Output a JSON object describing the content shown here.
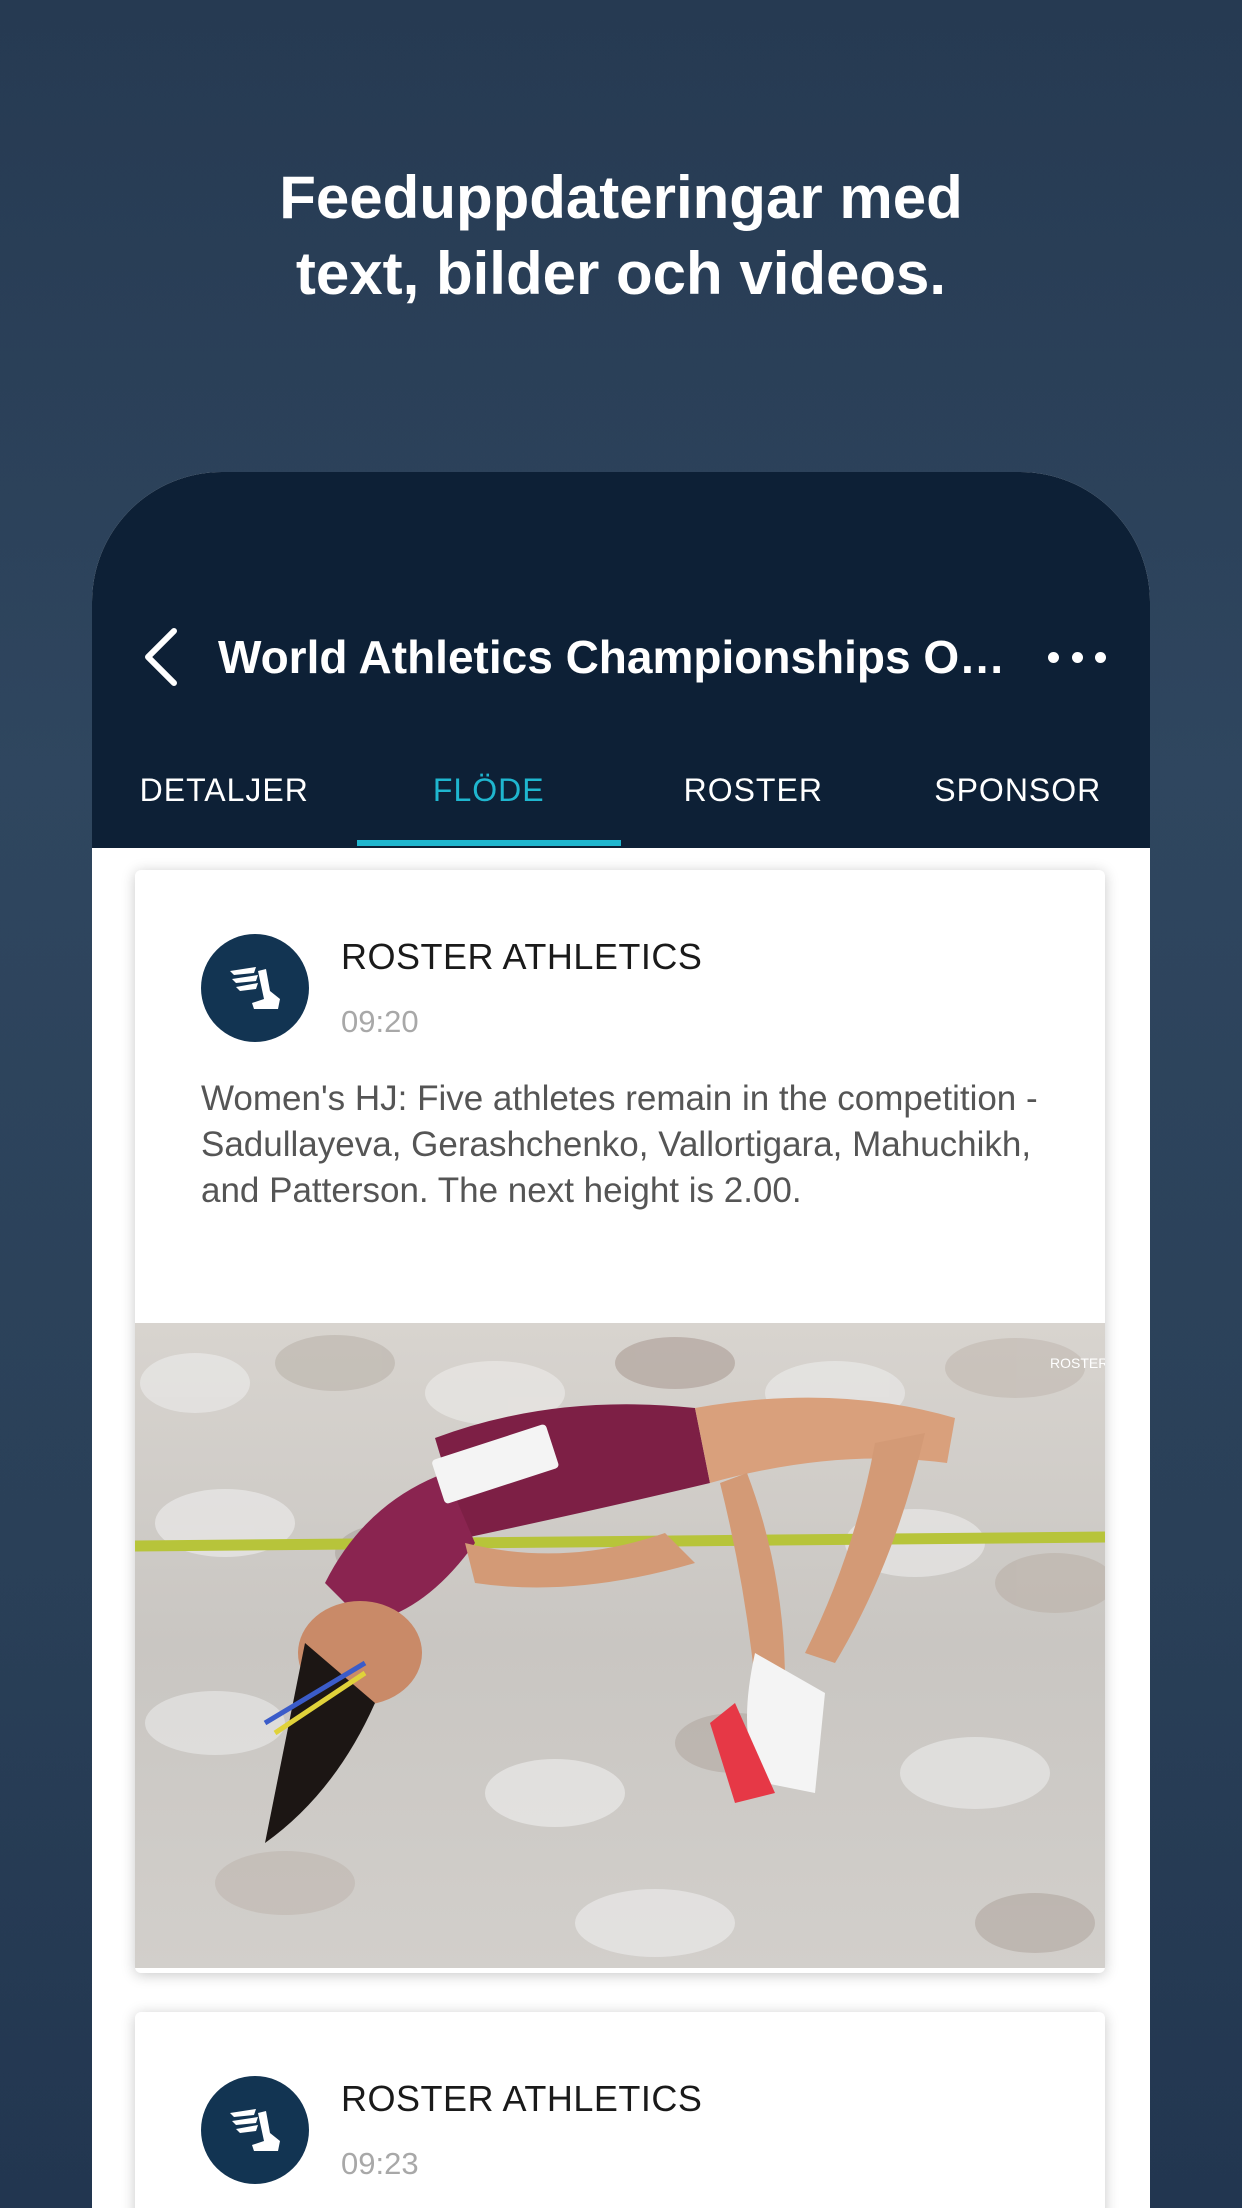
{
  "promo": {
    "headline_line1": "Feeduppdateringar med",
    "headline_line2": "text, bilder och videos."
  },
  "header": {
    "back_icon": "chevron-left-icon",
    "title": "World Athletics Championships Ore...",
    "more_icon": "more-horizontal-icon"
  },
  "tabs": [
    {
      "label": "DETALJER",
      "active": false
    },
    {
      "label": "FLÖDE",
      "active": true
    },
    {
      "label": "ROSTER",
      "active": false
    },
    {
      "label": "SPONSOR",
      "active": false
    }
  ],
  "feed": [
    {
      "author": "ROSTER ATHLETICS",
      "time": "09:20",
      "text": "Women's HJ: Five athletes remain in the competition - Sadullayeva, Gerashchenko, Vallortigara, Mahuchikh, and Patterson. The next height is 2.00.",
      "image": "high-jump-athlete-photo"
    },
    {
      "author": "ROSTER ATHLETICS",
      "time": "09:23"
    }
  ],
  "colors": {
    "background": "#2a4058",
    "appbar": "#0d2036",
    "accent": "#1fb6cf",
    "avatar": "#123452"
  }
}
